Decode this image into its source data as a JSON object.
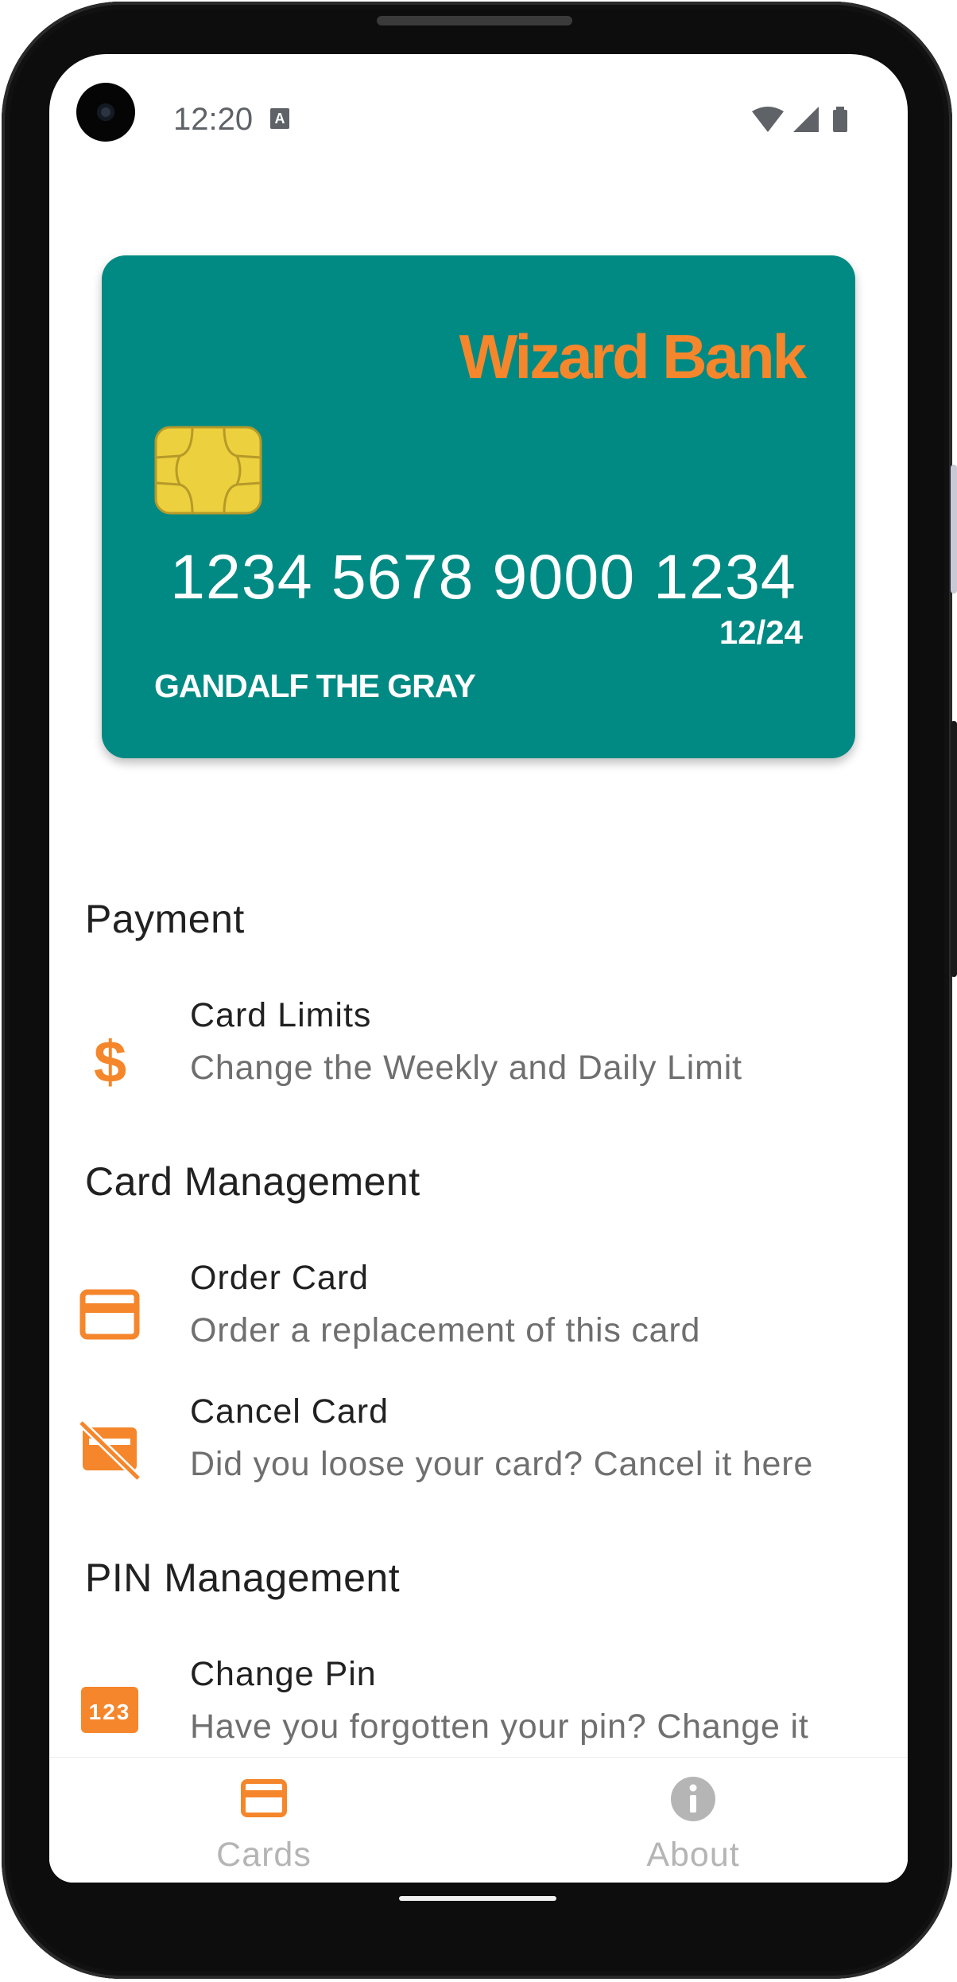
{
  "status_bar": {
    "time": "12:20",
    "notification_icon_letter": "A"
  },
  "card": {
    "bank_name": "Wizard Bank",
    "number": "1234 5678 9000 1234",
    "expiry": "12/24",
    "holder": "GANDALF THE GRAY",
    "background_color": "#008a83",
    "brand_color": "#f5862b"
  },
  "sections": [
    {
      "title": "Payment",
      "items": [
        {
          "icon": "dollar-icon",
          "title": "Card Limits",
          "subtitle": "Change the Weekly and Daily Limit"
        }
      ]
    },
    {
      "title": "Card Management",
      "items": [
        {
          "icon": "credit-card-icon",
          "title": "Order Card",
          "subtitle": "Order a replacement of this card"
        },
        {
          "icon": "credit-card-off-icon",
          "title": "Cancel Card",
          "subtitle": "Did you loose your card? Cancel it here"
        }
      ]
    },
    {
      "title": "PIN Management",
      "items": [
        {
          "icon": "pin-123-icon",
          "icon_text": "123",
          "title": "Change Pin",
          "subtitle": "Have you forgotten your pin? Change it"
        }
      ]
    }
  ],
  "bottom_nav": {
    "items": [
      {
        "label": "Cards",
        "icon": "credit-card-icon",
        "selected": true
      },
      {
        "label": "About",
        "icon": "info-icon",
        "selected": false
      }
    ]
  },
  "accent_color": "#f5862b"
}
